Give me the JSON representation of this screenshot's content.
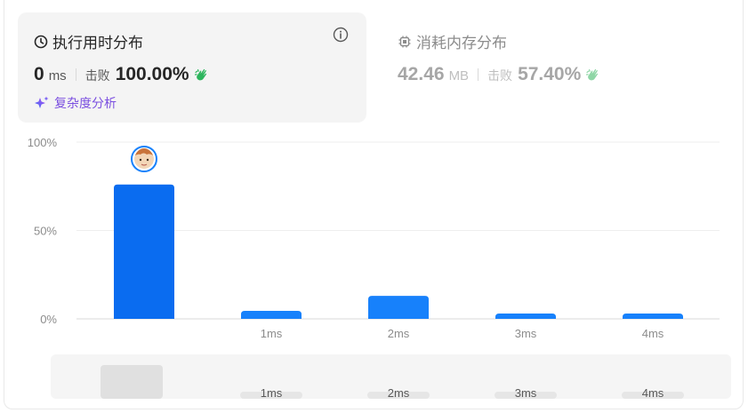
{
  "runtime": {
    "title": "执行用时分布",
    "value": "0",
    "unit": "ms",
    "beat_label": "击败",
    "beat_percent": "100.00%",
    "analysis_label": "复杂度分析",
    "icons": {
      "title": "clock-icon",
      "info": "info-icon",
      "hand": "clap-hand-icon",
      "analysis": "sparkle-icon"
    }
  },
  "memory": {
    "title": "消耗内存分布",
    "value": "42.46",
    "unit": "MB",
    "beat_label": "击败",
    "beat_percent": "57.40%",
    "icons": {
      "title": "chip-icon",
      "hand": "clap-hand-icon"
    }
  },
  "colors": {
    "accent_bar": "#0a6cf0",
    "bar": "#1781fb",
    "hand_green": "#2db55d",
    "analysis_purple": "#7b4fe0"
  },
  "chart_data": {
    "type": "bar",
    "categories": [
      "0ms",
      "1ms",
      "2ms",
      "3ms",
      "4ms"
    ],
    "tick_labels": [
      "",
      "1ms",
      "2ms",
      "3ms",
      "4ms"
    ],
    "values": [
      76,
      4.5,
      13,
      3,
      3
    ],
    "highlighted_index": 0,
    "ylim": [
      0,
      100
    ],
    "y_ticks": [
      "0%",
      "50%",
      "100%"
    ],
    "grid": true,
    "navigator": {
      "tick_labels": [
        "",
        "1ms",
        "2ms",
        "3ms",
        "4ms"
      ]
    }
  }
}
